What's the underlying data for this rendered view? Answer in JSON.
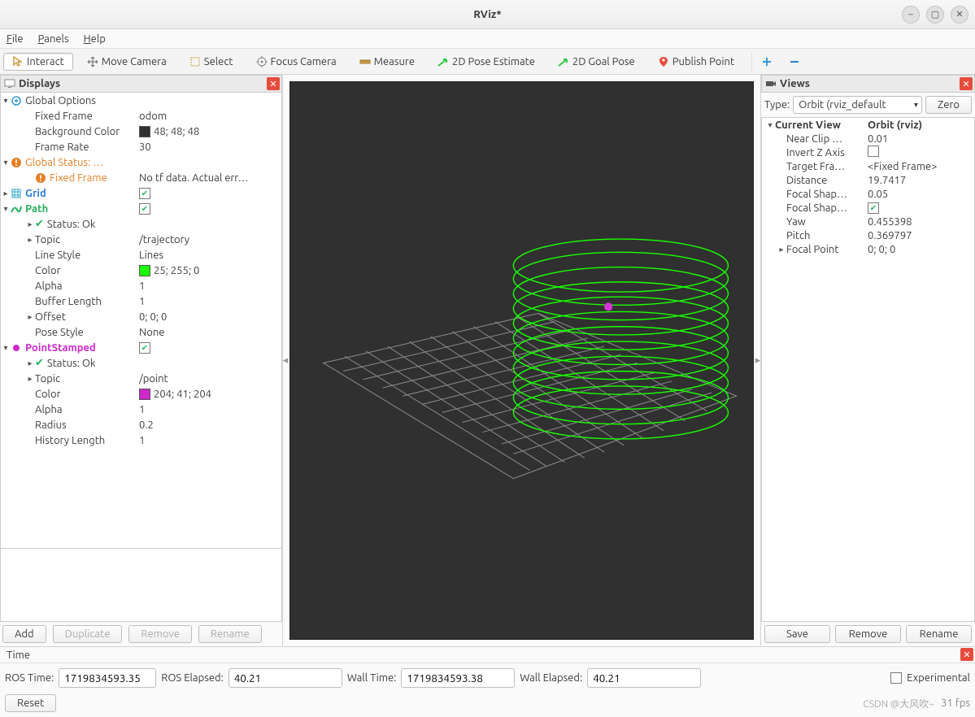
{
  "window": {
    "title": "RViz*"
  },
  "menu": {
    "file": "File",
    "panels": "Panels",
    "help": "Help"
  },
  "toolbar": {
    "interact": "Interact",
    "move_camera": "Move Camera",
    "select": "Select",
    "focus_camera": "Focus Camera",
    "measure": "Measure",
    "pose_estimate": "2D Pose Estimate",
    "goal_pose": "2D Goal Pose",
    "publish_point": "Publish Point"
  },
  "displays_panel": {
    "title": "Displays",
    "global_options": {
      "label": "Global Options",
      "fixed_frame": {
        "label": "Fixed Frame",
        "value": "odom"
      },
      "bg_color": {
        "label": "Background Color",
        "value": "48; 48; 48",
        "hex": "#303030"
      },
      "frame_rate": {
        "label": "Frame Rate",
        "value": "30"
      }
    },
    "global_status": {
      "label": "Global Status: …",
      "fixed_frame": {
        "label": "Fixed Frame",
        "value": "No tf data.  Actual err…"
      }
    },
    "grid": {
      "label": "Grid",
      "checked": true
    },
    "path": {
      "label": "Path",
      "checked": true,
      "status": "Status: Ok",
      "topic": {
        "label": "Topic",
        "value": "/trajectory"
      },
      "line_style": {
        "label": "Line Style",
        "value": "Lines"
      },
      "color": {
        "label": "Color",
        "value": "25; 255; 0",
        "hex": "#19ff00"
      },
      "alpha": {
        "label": "Alpha",
        "value": "1"
      },
      "buffer_length": {
        "label": "Buffer Length",
        "value": "1"
      },
      "offset": {
        "label": "Offset",
        "value": "0; 0; 0"
      },
      "pose_style": {
        "label": "Pose Style",
        "value": "None"
      }
    },
    "point_stamped": {
      "label": "PointStamped",
      "checked": true,
      "status": "Status: Ok",
      "topic": {
        "label": "Topic",
        "value": "/point"
      },
      "color": {
        "label": "Color",
        "value": "204; 41; 204",
        "hex": "#cc29cc"
      },
      "alpha": {
        "label": "Alpha",
        "value": "1"
      },
      "radius": {
        "label": "Radius",
        "value": "0.2"
      },
      "history_length": {
        "label": "History Length",
        "value": "1"
      }
    },
    "buttons": {
      "add": "Add",
      "duplicate": "Duplicate",
      "remove": "Remove",
      "rename": "Rename"
    }
  },
  "views_panel": {
    "title": "Views",
    "type_label": "Type:",
    "type_value": "Orbit (rviz_default",
    "zero": "Zero",
    "current_view": {
      "label": "Current View",
      "value": "Orbit (rviz)"
    },
    "props": {
      "near_clip": {
        "label": "Near Clip …",
        "value": "0.01"
      },
      "invert_z": {
        "label": "Invert Z Axis",
        "checked": false
      },
      "target_frame": {
        "label": "Target Fra…",
        "value": "<Fixed Frame>"
      },
      "distance": {
        "label": "Distance",
        "value": "19.7417"
      },
      "focal_shape_size": {
        "label": "Focal Shap…",
        "value": "0.05"
      },
      "focal_shape_fixed": {
        "label": "Focal Shap…",
        "checked": true
      },
      "yaw": {
        "label": "Yaw",
        "value": "0.455398"
      },
      "pitch": {
        "label": "Pitch",
        "value": "0.369797"
      },
      "focal_point": {
        "label": "Focal Point",
        "value": "0; 0; 0"
      }
    },
    "buttons": {
      "save": "Save",
      "remove": "Remove",
      "rename": "Rename"
    }
  },
  "time_panel": {
    "title": "Time",
    "ros_time": {
      "label": "ROS Time:",
      "value": "1719834593.35"
    },
    "ros_elapsed": {
      "label": "ROS Elapsed:",
      "value": "40.21"
    },
    "wall_time": {
      "label": "Wall Time:",
      "value": "1719834593.38"
    },
    "wall_elapsed": {
      "label": "Wall Elapsed:",
      "value": "40.21"
    },
    "experimental": "Experimental",
    "reset": "Reset",
    "fps": "31 fps"
  },
  "watermark": "CSDN @大风吹~"
}
